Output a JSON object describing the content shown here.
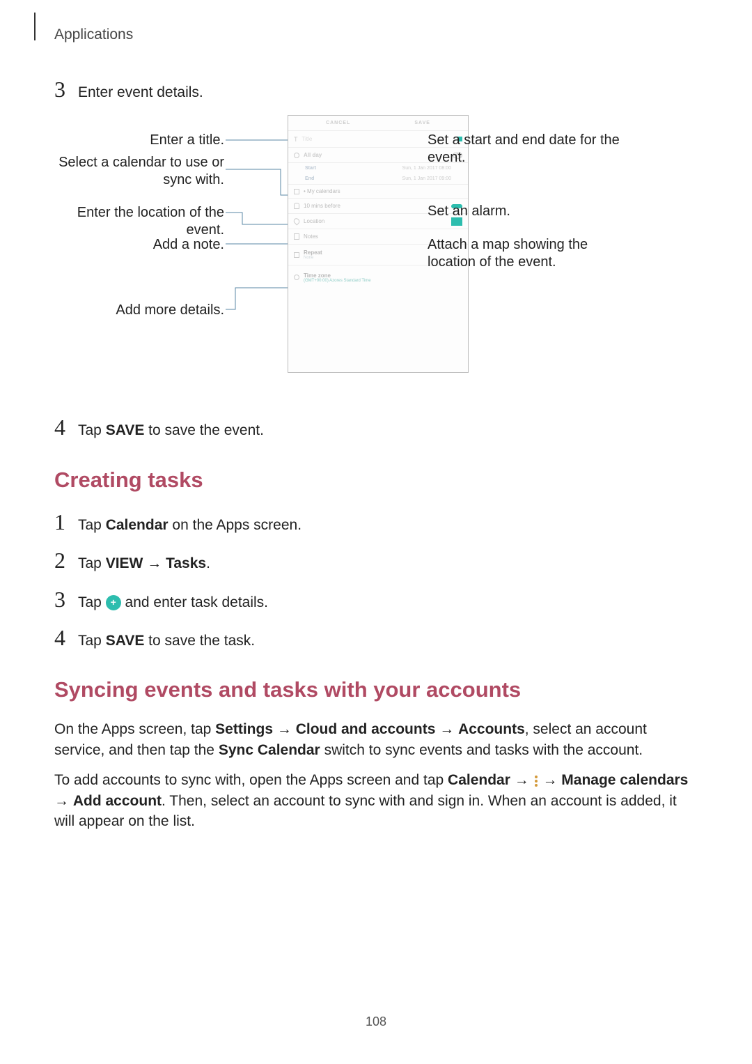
{
  "header": {
    "section": "Applications"
  },
  "steps_a": {
    "s3": "Enter event details.",
    "s4_pre": "Tap ",
    "s4_bold": "SAVE",
    "s4_post": " to save the event."
  },
  "callouts": {
    "title": "Enter a title.",
    "calendar_l1": "Select a calendar to use or",
    "calendar_l2": "sync with.",
    "location": "Enter the location of the event.",
    "note": "Add a note.",
    "more": "Add more details.",
    "date_l1": "Set a start and end date for the",
    "date_l2": "event.",
    "alarm": "Set an alarm.",
    "map_l1": "Attach a map showing the",
    "map_l2": "location of the event."
  },
  "phone": {
    "cancel": "CANCEL",
    "save": "SAVE",
    "title_ph": "Title",
    "allday": "All day",
    "start_lbl": "Start",
    "start_val": "Sun, 1 Jan 2017  08:00",
    "end_lbl": "End",
    "end_val": "Sun, 1 Jan 2017  09:00",
    "calendar": "My calendars",
    "alarm_lbl": "10 mins before",
    "loc_ph": "Location",
    "note_ph": "Notes",
    "repeat_lbl": "Repeat",
    "repeat_sub": "None",
    "tz_lbl": "Time zone",
    "tz_sub": "(GMT+00:00) Azores Standard Time"
  },
  "heading_tasks": "Creating tasks",
  "tasks": {
    "s1_a": "Tap ",
    "s1_b": "Calendar",
    "s1_c": " on the Apps screen.",
    "s2_a": "Tap ",
    "s2_b": "VIEW",
    "s2_c": "Tasks",
    "s2_d": ".",
    "s3_a": "Tap ",
    "s3_b": " and enter task details.",
    "s4_a": "Tap ",
    "s4_b": "SAVE",
    "s4_c": " to save the task."
  },
  "heading_sync": "Syncing events and tasks with your accounts",
  "sync": {
    "p1_a": "On the Apps screen, tap ",
    "p1_b": "Settings",
    "p1_c": "Cloud and accounts",
    "p1_d": "Accounts",
    "p1_e": ", select an account service, and then tap the ",
    "p1_f": "Sync Calendar",
    "p1_g": " switch to sync events and tasks with the account.",
    "p2_a": "To add accounts to sync with, open the Apps screen and tap ",
    "p2_b": "Calendar",
    "p2_c": "Manage calendars",
    "p2_d": "Add account",
    "p2_e": ". Then, select an account to sync with and sign in. When an account is added, it will appear on the list."
  },
  "arrow": "→",
  "nums": {
    "n1": "1",
    "n2": "2",
    "n3": "3",
    "n4": "4"
  },
  "page_number": "108"
}
